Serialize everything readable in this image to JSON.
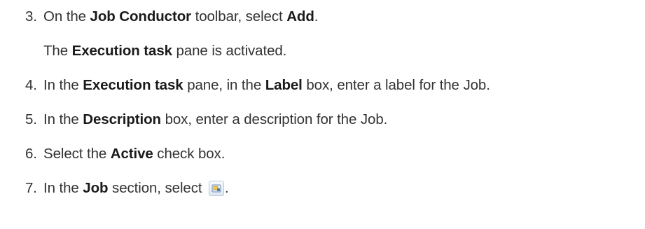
{
  "steps": [
    {
      "num": "3.",
      "t0": "On the ",
      "b0": "Job Conductor",
      "t1": " toolbar, select ",
      "b1": "Add",
      "t2": "."
    },
    {
      "note": true,
      "t0": "The ",
      "b0": "Execution task",
      "t1": " pane is activated."
    },
    {
      "num": "4.",
      "t0": "In the ",
      "b0": "Execution task",
      "t1": " pane, in the ",
      "b1": "Label",
      "t2": " box, enter a label for the Job."
    },
    {
      "num": "5.",
      "t0": "In the ",
      "b0": "Description",
      "t1": " box, enter a description for the Job."
    },
    {
      "num": "6.",
      "t0": "Select the ",
      "b0": "Active",
      "t1": " check box."
    },
    {
      "num": "7.",
      "t0": "In the ",
      "b0": "Job",
      "t1": " section, select ",
      "icon": "select-job-icon",
      "t2": "."
    }
  ]
}
